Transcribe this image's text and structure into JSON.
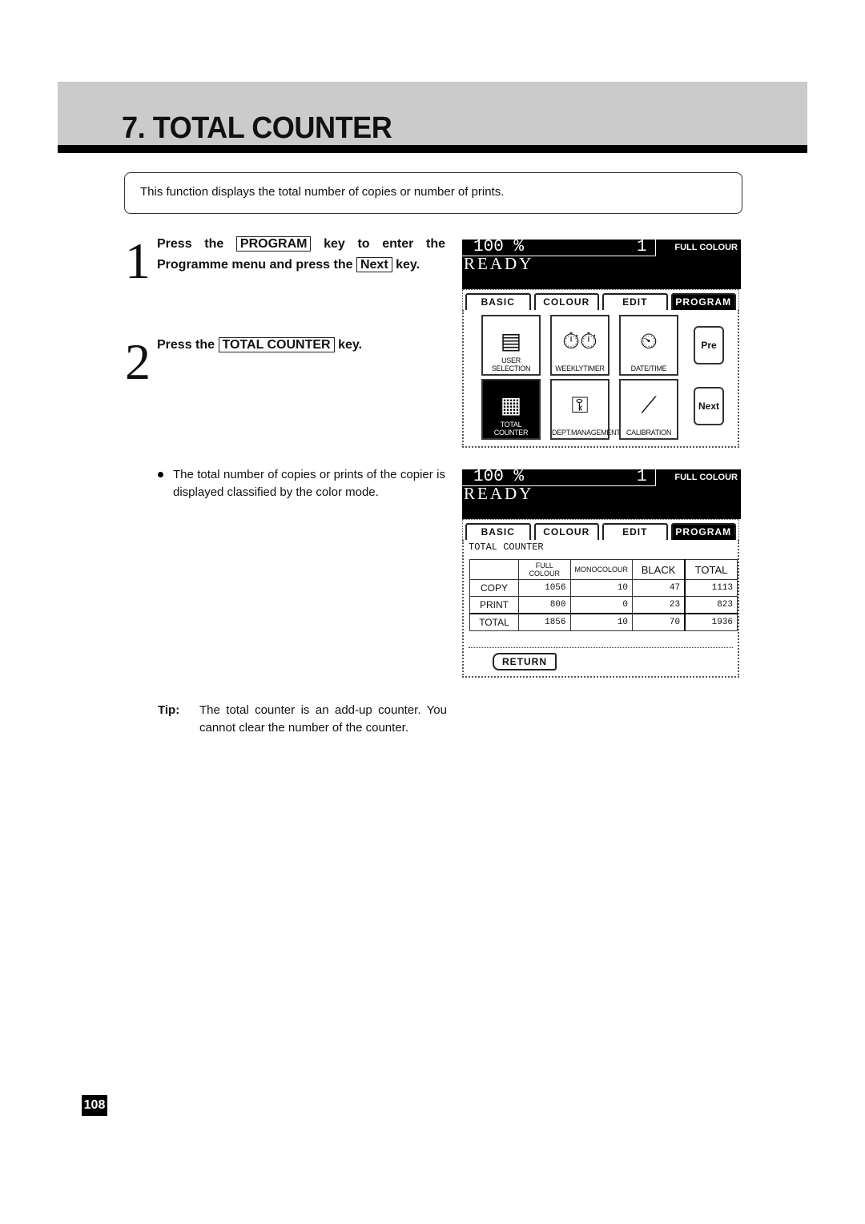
{
  "page": {
    "title": "7. TOTAL COUNTER",
    "intro": "This function displays the total number of copies or number of prints.",
    "page_number": "108"
  },
  "steps": [
    {
      "number": "1",
      "text_a": "Press the",
      "key_a": "PROGRAM",
      "text_b": "key to enter the Programme menu and press the",
      "key_b": "Next",
      "text_c": "key."
    },
    {
      "number": "2",
      "text_a": "Press the",
      "key_a": "TOTAL COUNTER",
      "text_b": "key."
    }
  ],
  "note": "The total number of copies or prints of the copier is displayed classified by the color mode.",
  "tip": {
    "label": "Tip:",
    "text": "The total counter is an add-up counter. You cannot clear the number of the counter."
  },
  "screen_common": {
    "zoom": "100 %",
    "copies": "1",
    "mode": "FULL COLOUR",
    "status": "READY",
    "tabs": [
      "BASIC",
      "COLOUR",
      "EDIT",
      "PROGRAM"
    ],
    "active_tab": "PROGRAM"
  },
  "screen1": {
    "tiles": [
      {
        "label": "USER SELECTION",
        "icon": "user-selection-icon",
        "glyph": "▤"
      },
      {
        "label": "WEEKLYTIMER",
        "icon": "weekly-timer-icon",
        "glyph": "⏱⏱"
      },
      {
        "label": "DATE/TIME",
        "icon": "stopwatch-icon",
        "glyph": "⏲"
      },
      {
        "label": "TOTAL COUNTER",
        "icon": "counter-table-icon",
        "glyph": "▦"
      },
      {
        "label": "DEPT.MANAGEMENT",
        "icon": "key-icon",
        "glyph": "⚿"
      },
      {
        "label": "CALIBRATION",
        "icon": "calibration-graph-icon",
        "glyph": "⟋"
      }
    ],
    "pre_label": "Pre",
    "next_label": "Next"
  },
  "screen2": {
    "heading": "TOTAL COUNTER",
    "columns": [
      "",
      "FULL COLOUR",
      "MONOCOLOUR",
      "BLACK",
      "TOTAL"
    ],
    "rows": [
      {
        "label": "COPY",
        "values": [
          "1056",
          "10",
          "47",
          "1113"
        ]
      },
      {
        "label": "PRINT",
        "values": [
          "800",
          "0",
          "23",
          "823"
        ]
      },
      {
        "label": "TOTAL",
        "values": [
          "1856",
          "10",
          "70",
          "1936"
        ]
      }
    ],
    "return_label": "RETURN"
  }
}
